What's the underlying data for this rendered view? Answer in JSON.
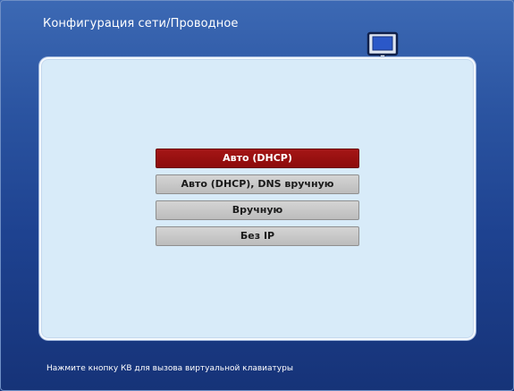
{
  "header": {
    "title": "Конфигурация сети/Проводное",
    "icon": "wired-network-icon"
  },
  "menu": {
    "items": [
      {
        "label": "Авто (DHCP)",
        "selected": true
      },
      {
        "label": "Авто (DHCP), DNS вручную",
        "selected": false
      },
      {
        "label": "Вручную",
        "selected": false
      },
      {
        "label": "Без IP",
        "selected": false
      }
    ]
  },
  "footer": {
    "hint": "Нажмите кнопку КВ для вызова виртуальной клавиатуры"
  },
  "colors": {
    "background_top": "#3c69b4",
    "background_bottom": "#163378",
    "panel": "#d8ebf9",
    "selected_item": "#a51616",
    "item": "#c8c8c8"
  }
}
